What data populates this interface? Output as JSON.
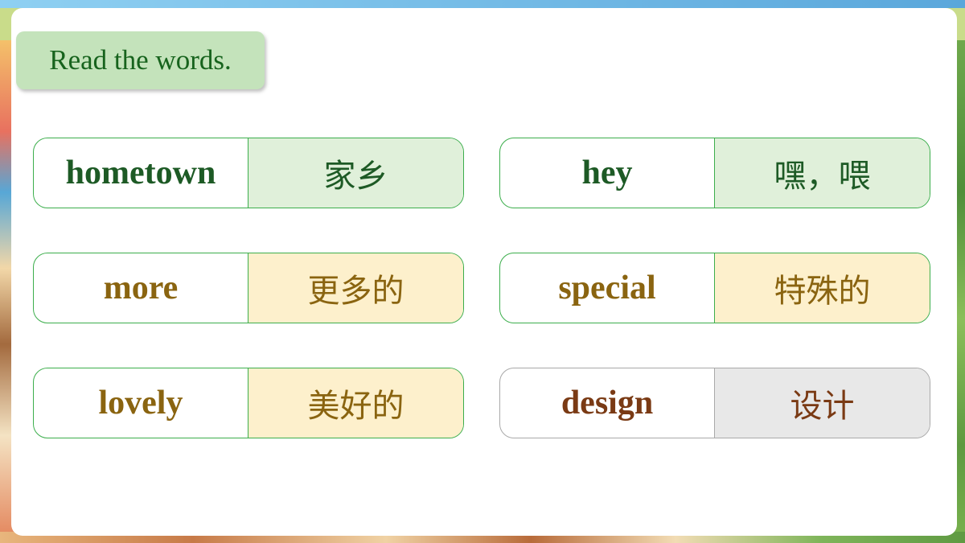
{
  "instruction": "Read the words.",
  "words": [
    {
      "en": "hometown",
      "zh": "家乡"
    },
    {
      "en": "hey",
      "zh": "嘿，喂"
    },
    {
      "en": "more",
      "zh": "更多的"
    },
    {
      "en": "special",
      "zh": "特殊的"
    },
    {
      "en": "lovely",
      "zh": "美好的"
    },
    {
      "en": "design",
      "zh": "设计"
    }
  ],
  "colors": {
    "instruction_bg": "#c4e3bb",
    "instruction_text": "#17631d",
    "card_border": "#3cae4c",
    "row1_word": "#1d5a25",
    "row1_meaning_bg": "#e0f0da",
    "row23_word": "#8a6410",
    "row23_meaning_bg": "#fdf0cc",
    "design_word": "#7a3a14",
    "design_meaning_bg": "#e8e8e8",
    "design_border": "#a9a9a9"
  }
}
